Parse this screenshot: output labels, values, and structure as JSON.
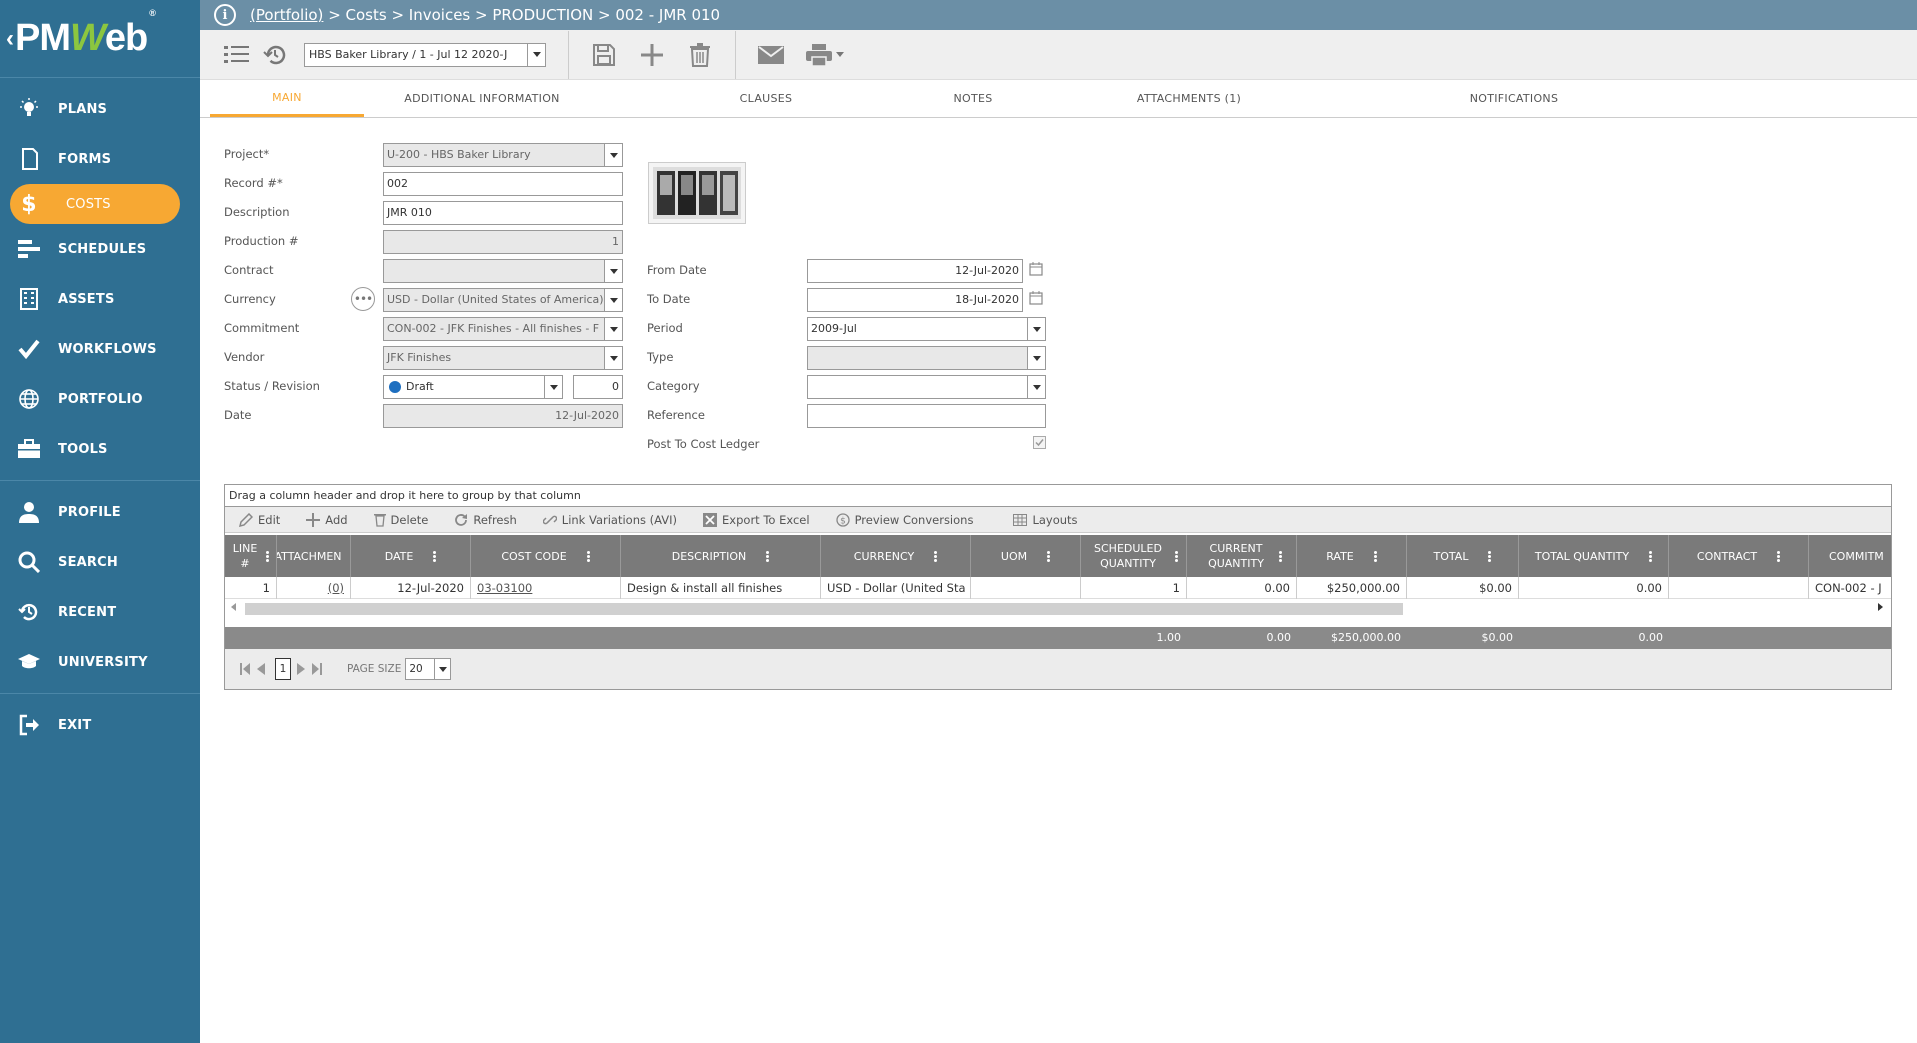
{
  "app": {
    "logo_prefix": "PM",
    "logo_w": "W",
    "logo_suffix": "eb",
    "logo_reg": "®"
  },
  "sidebar": {
    "items": [
      {
        "label": "PLANS",
        "icon": "lightbulb-icon"
      },
      {
        "label": "FORMS",
        "icon": "document-icon"
      },
      {
        "label": "COSTS",
        "icon": "dollar-icon",
        "active": true
      },
      {
        "label": "SCHEDULES",
        "icon": "schedule-bars-icon"
      },
      {
        "label": "ASSETS",
        "icon": "building-icon"
      },
      {
        "label": "WORKFLOWS",
        "icon": "checkmark-icon"
      },
      {
        "label": "PORTFOLIO",
        "icon": "globe-icon"
      },
      {
        "label": "TOOLS",
        "icon": "toolbox-icon"
      },
      {
        "label": "PROFILE",
        "icon": "person-icon"
      },
      {
        "label": "SEARCH",
        "icon": "search-icon"
      },
      {
        "label": "RECENT",
        "icon": "history-icon"
      },
      {
        "label": "UNIVERSITY",
        "icon": "graduation-cap-icon"
      },
      {
        "label": "EXIT",
        "icon": "exit-icon"
      }
    ]
  },
  "header": {
    "breadcrumb_link": "(Portfolio)",
    "breadcrumb_rest": " > Costs > Invoices > PRODUCTION > 002 - JMR 010"
  },
  "toolbar": {
    "record_selector": "HBS Baker Library / 1 - Jul 12 2020-J"
  },
  "tabs": [
    {
      "label": "MAIN",
      "active": true
    },
    {
      "label": "ADDITIONAL INFORMATION"
    },
    {
      "label": "CLAUSES"
    },
    {
      "label": "NOTES"
    },
    {
      "label": "ATTACHMENTS (1)"
    },
    {
      "label": "NOTIFICATIONS"
    }
  ],
  "form": {
    "project_label": "Project*",
    "project_value": "U-200 - HBS Baker Library",
    "record_label": "Record #*",
    "record_value": "002",
    "description_label": "Description",
    "description_value": "JMR 010",
    "production_label": "Production #",
    "production_value": "1",
    "contract_label": "Contract",
    "contract_value": "",
    "currency_label": "Currency",
    "currency_value": "USD - Dollar (United States of America)",
    "commitment_label": "Commitment",
    "commitment_value": "CON-002 - JFK Finishes - All finishes - F",
    "vendor_label": "Vendor",
    "vendor_value": "JFK Finishes",
    "status_label": "Status / Revision",
    "status_value": "Draft",
    "revision_value": "0",
    "date_label": "Date",
    "date_value": "12-Jul-2020",
    "from_date_label": "From Date",
    "from_date_value": "12-Jul-2020",
    "to_date_label": "To Date",
    "to_date_value": "18-Jul-2020",
    "period_label": "Period",
    "period_value": "2009-Jul",
    "type_label": "Type",
    "type_value": "",
    "category_label": "Category",
    "category_value": "",
    "reference_label": "Reference",
    "reference_value": "",
    "post_label": "Post To Cost Ledger",
    "post_checked": true
  },
  "grid": {
    "group_hint": "Drag a column header and drop it here to group by that column",
    "tools": [
      {
        "label": "Edit",
        "icon": "pencil-icon"
      },
      {
        "label": "Add",
        "icon": "plus-icon"
      },
      {
        "label": "Delete",
        "icon": "trash-icon"
      },
      {
        "label": "Refresh",
        "icon": "refresh-icon"
      },
      {
        "label": "Link Variations (AVI)",
        "icon": "link-icon"
      },
      {
        "label": "Export To Excel",
        "icon": "excel-icon"
      },
      {
        "label": "Preview Conversions",
        "icon": "currency-icon"
      },
      {
        "label": "Layouts",
        "icon": "layouts-icon"
      }
    ],
    "columns": [
      "LINE #",
      "ATTACHMEN",
      "DATE",
      "COST CODE",
      "DESCRIPTION",
      "CURRENCY",
      "UOM",
      "SCHEDULED QUANTITY",
      "CURRENT QUANTITY",
      "RATE",
      "TOTAL",
      "TOTAL QUANTITY",
      "CONTRACT",
      "COMMITM"
    ],
    "rows": [
      {
        "line": "1",
        "attachments": "(0)",
        "date": "12-Jul-2020",
        "cost_code": "03-03100",
        "description": "Design & install all finishes",
        "currency": "USD - Dollar (United Sta",
        "uom": "",
        "scheduled_quantity": "1",
        "current_quantity": "0.00",
        "rate": "$250,000.00",
        "total": "$0.00",
        "total_quantity": "0.00",
        "contract": "",
        "commitment": "CON-002 - J"
      }
    ],
    "footer": {
      "scheduled_quantity": "1.00",
      "current_quantity": "0.00",
      "rate": "$250,000.00",
      "total": "$0.00",
      "total_quantity": "0.00"
    },
    "pager": {
      "current_page": "1",
      "page_size_label": "PAGE SIZE",
      "page_size": "20"
    }
  },
  "colors": {
    "sidebar": "#2f6f92",
    "accent": "#f7a833",
    "header": "#6b8fa6"
  }
}
